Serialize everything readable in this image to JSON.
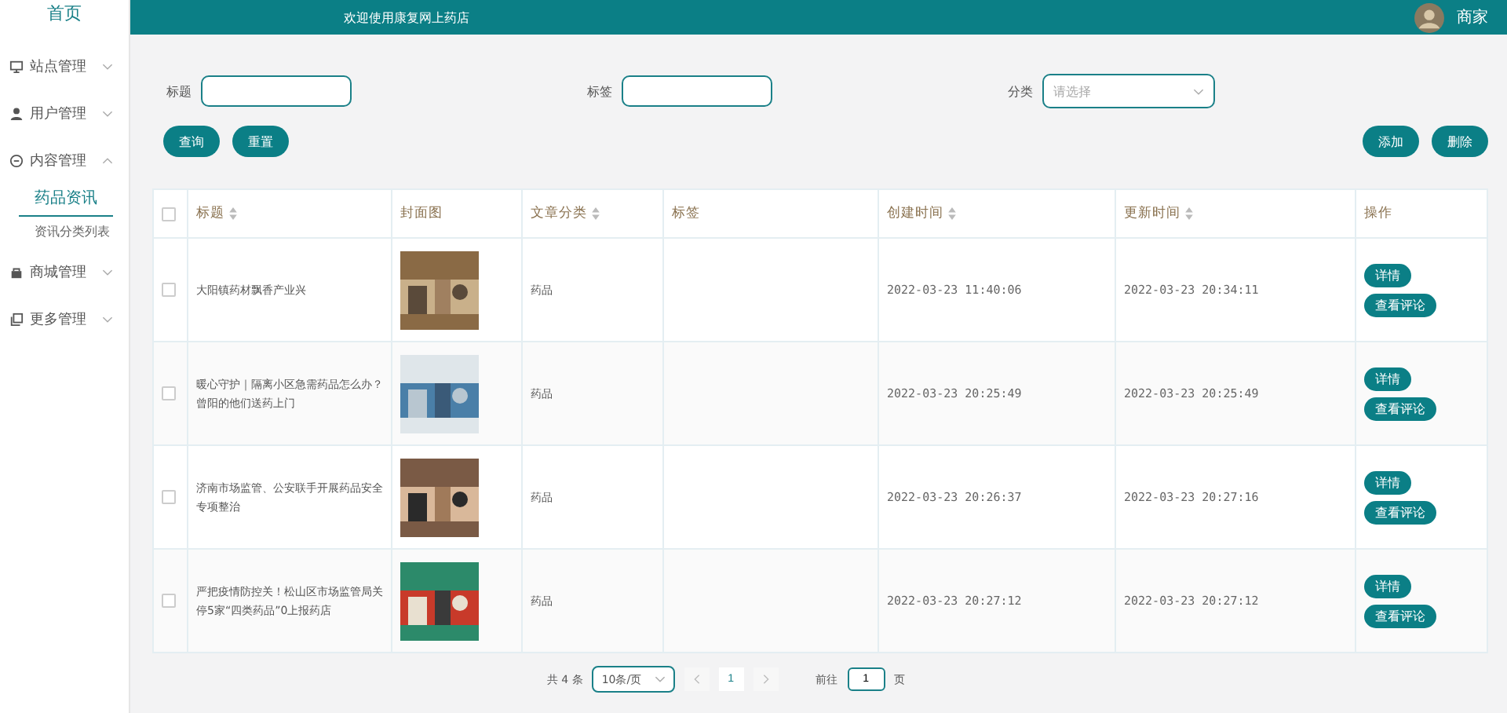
{
  "sidebar": {
    "home": "首页",
    "items": [
      {
        "label": "站点管理",
        "expanded": false
      },
      {
        "label": "用户管理",
        "expanded": false
      },
      {
        "label": "内容管理",
        "expanded": true,
        "children": [
          {
            "label": "药品资讯",
            "selected": true
          },
          {
            "label": "资讯分类列表",
            "selected": false
          }
        ]
      },
      {
        "label": "商城管理",
        "expanded": false
      },
      {
        "label": "更多管理",
        "expanded": false
      }
    ]
  },
  "header": {
    "welcome": "欢迎使用康复网上药店",
    "user": "商家"
  },
  "filters": {
    "title_label": "标题",
    "tag_label": "标签",
    "category_label": "分类",
    "category_placeholder": "请选择"
  },
  "buttons": {
    "search": "查询",
    "reset": "重置",
    "add": "添加",
    "delete": "删除"
  },
  "table": {
    "select_all_checked": false,
    "columns": [
      {
        "label": "标题",
        "sortable": true
      },
      {
        "label": "封面图",
        "sortable": false
      },
      {
        "label": "文章分类",
        "sortable": true
      },
      {
        "label": "标签",
        "sortable": false
      },
      {
        "label": "创建时间",
        "sortable": true
      },
      {
        "label": "更新时间",
        "sortable": true
      },
      {
        "label": "操作",
        "sortable": false
      }
    ],
    "rows": [
      {
        "checked": false,
        "title": "大阳镇药材飘香产业兴",
        "category": "药品",
        "created": "2022-03-23 11:40:06",
        "updated": "2022-03-23 20:34:11",
        "actions": [
          "详情",
          "查看评论"
        ]
      },
      {
        "checked": false,
        "title": "暖心守护｜隔离小区急需药品怎么办？曾阳的他们送药上门",
        "category": "药品",
        "created": "2022-03-23 20:25:49",
        "updated": "2022-03-23 20:25:49",
        "actions": [
          "详情",
          "查看评论"
        ]
      },
      {
        "checked": false,
        "title": "济南市场监管、公安联手开展药品安全专项整治",
        "category": "药品",
        "created": "2022-03-23 20:26:37",
        "updated": "2022-03-23 20:27:16",
        "actions": [
          "详情",
          "查看评论"
        ]
      },
      {
        "checked": false,
        "title": "严把疫情防控关！松山区市场监管局关停5家“四类药品”0上报药店",
        "category": "药品",
        "created": "2022-03-23 20:27:12",
        "updated": "2022-03-23 20:27:12",
        "actions": [
          "详情",
          "查看评论"
        ]
      }
    ]
  },
  "pagination": {
    "total": "共 4 条",
    "page_size": "10条/页",
    "current": "1",
    "goto_label": "前往",
    "goto_value": "1",
    "page_unit": "页"
  }
}
